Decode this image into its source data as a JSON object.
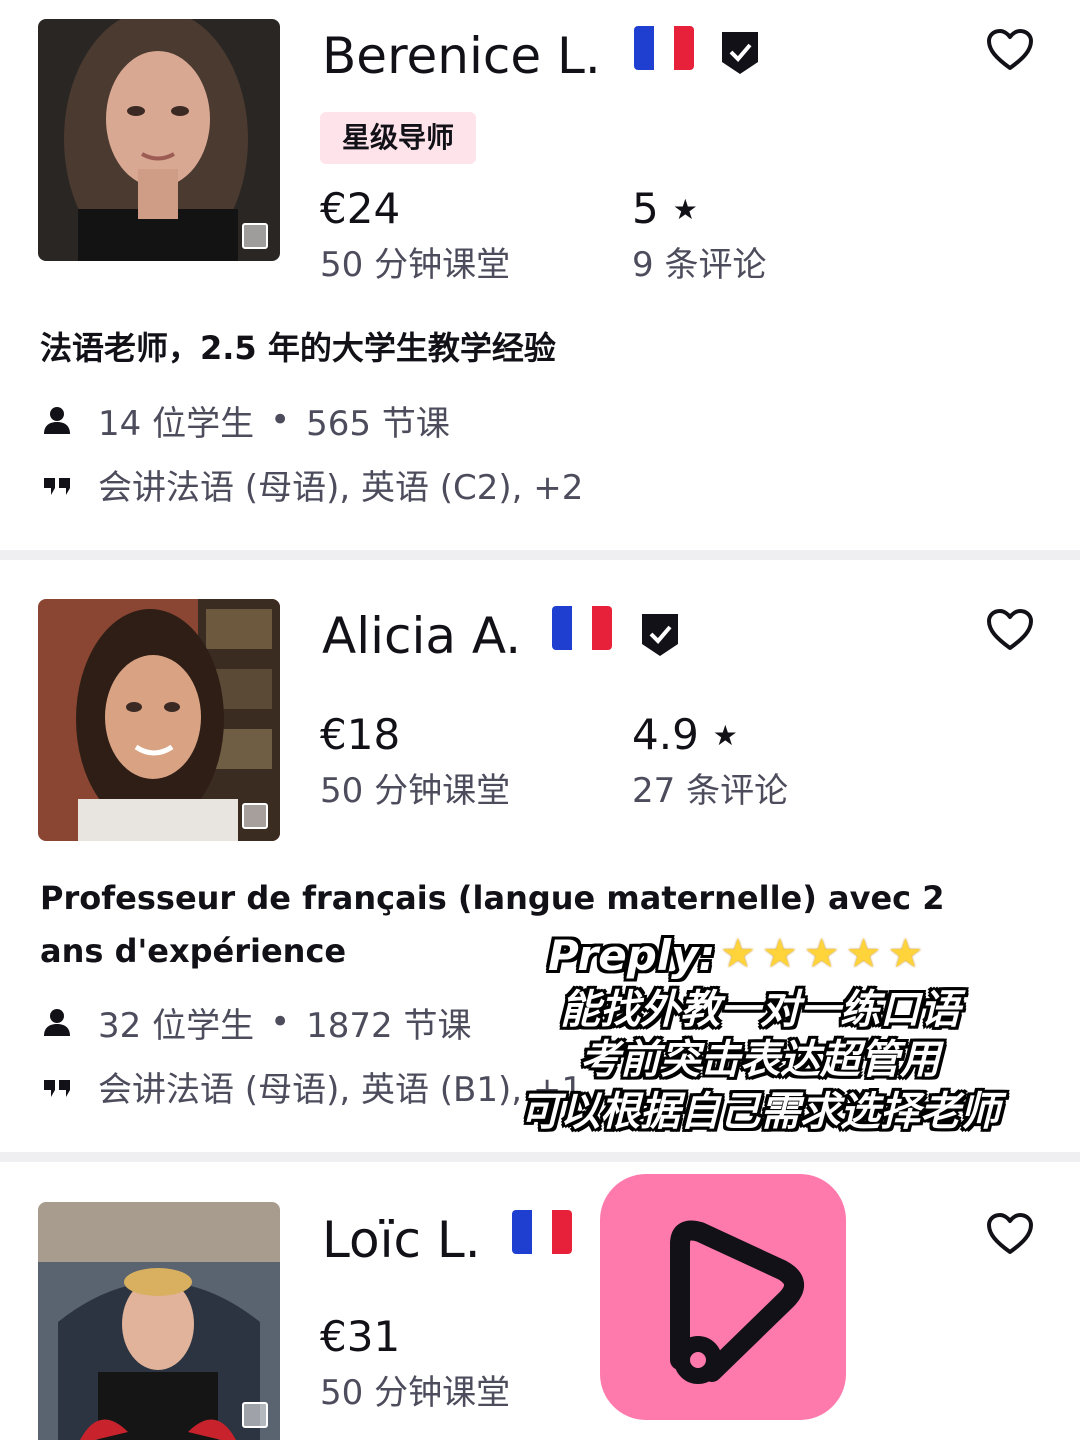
{
  "tutors": [
    {
      "name": "Berenice L.",
      "badge": "星级导师",
      "price": "€24",
      "price_sub": "50 分钟课堂",
      "rating": "5",
      "reviews": "9 条评论",
      "headline": "法语老师，2.5 年的大学生教学经验",
      "students": "14 位学生",
      "lessons": "565 节课",
      "languages": "会讲法语 (母语), 英语 (C2), +2"
    },
    {
      "name": "Alicia A.",
      "price": "€18",
      "price_sub": "50 分钟课堂",
      "rating": "4.9",
      "reviews": "27 条评论",
      "headline": "Professeur de français (langue maternelle) avec 2 ans d'expérience",
      "students": "32 位学生",
      "lessons": "1872 节课",
      "languages": "会讲法语 (母语), 英语 (B1), +1"
    },
    {
      "name": "Loïc L.",
      "price": "€31",
      "price_sub": "50 分钟课堂"
    }
  ],
  "symbols": {
    "star": "★",
    "dot": "•"
  },
  "overlay": {
    "brand": "Preply:",
    "stars": "★★★★★",
    "lines": [
      "能找外教一对一练口语",
      "考前突击表达超管用",
      "可以根据自己需求选择老师"
    ]
  },
  "icons": {
    "flag": "france-flag-icon",
    "verified": "verified-shield-icon",
    "favorite": "heart-outline-icon",
    "students": "person-icon",
    "languages": "speech-quote-icon",
    "app_logo": "preply-logo-icon"
  },
  "colors": {
    "badge_bg": "#ffe3ea",
    "logo_bg": "#ff7aac",
    "text_primary": "#121117",
    "text_secondary": "#4d4c5c",
    "divider": "#efeff2"
  }
}
